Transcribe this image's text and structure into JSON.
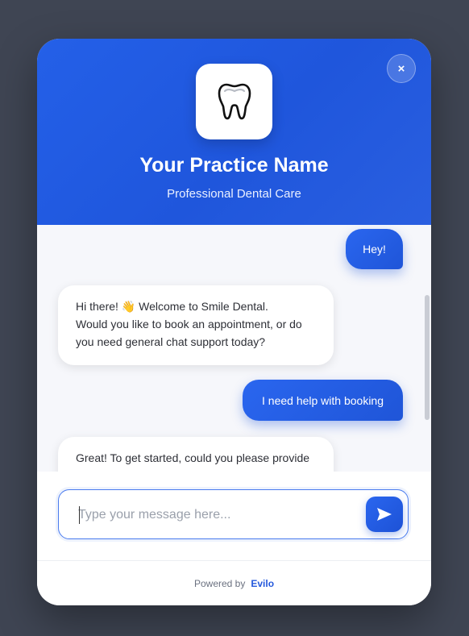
{
  "header": {
    "title": "Your Practice Name",
    "subtitle": "Professional Dental Care",
    "close_label": "×",
    "logo_icon": "tooth-icon"
  },
  "messages": [
    {
      "from": "user",
      "text": "Hey!"
    },
    {
      "from": "bot",
      "lines": [
        "Hi there! 👋 Welcome to Smile Dental.",
        "Would you like to book an appointment, or do",
        "you need general chat support today?"
      ]
    },
    {
      "from": "user",
      "text": "I need help with booking"
    },
    {
      "from": "bot",
      "lines": [
        "Great! To get started, could you please provide"
      ]
    }
  ],
  "composer": {
    "placeholder": "Type your message here...",
    "value": "",
    "send_icon": "send-icon"
  },
  "footer": {
    "powered_by": "Powered by",
    "brand": "Evilo"
  },
  "colors": {
    "accent": "#2460e8",
    "background": "#3f4553"
  }
}
